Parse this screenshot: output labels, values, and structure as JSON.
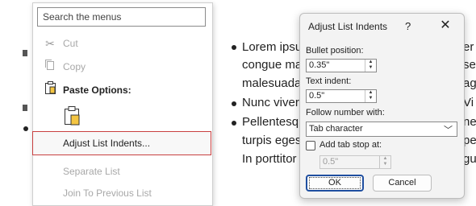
{
  "document": {
    "lines": [
      {
        "left": "Lorem ipsu",
        "right": "er"
      },
      {
        "left": "congue ma",
        "right": "sed"
      },
      {
        "left": "malesuada",
        "right": "ag"
      },
      {
        "left": "Nunc viver",
        "right": "Vi"
      },
      {
        "left": "Pellentesq",
        "right": "ne"
      },
      {
        "left": "turpis eges",
        "right": "pe"
      },
      {
        "left": "In porttitor",
        "right": "gue"
      }
    ]
  },
  "context_menu": {
    "search_placeholder": "Search the menus",
    "items": [
      {
        "label": "Cut",
        "key": "t",
        "icon": "scissors-icon",
        "enabled": false
      },
      {
        "label": "Copy",
        "key": "C",
        "icon": "copy-icon",
        "enabled": false
      },
      {
        "label": "Paste Options:",
        "icon": "clipboard-icon",
        "enabled": true,
        "header": true
      },
      {
        "label": "Adjust List Indents...",
        "key": "u",
        "enabled": true,
        "highlighted": true
      },
      {
        "label": "Separate List",
        "key": "L",
        "enabled": false
      },
      {
        "label": "Join To Previous List",
        "key": "J",
        "enabled": false
      }
    ]
  },
  "dialog": {
    "title": "Adjust List Indents",
    "help": "?",
    "close": "✕",
    "bullet_position_label": "Bullet position:",
    "bullet_position_value": "0.35\"",
    "text_indent_label": "Text indent:",
    "text_indent_value": "0.5\"",
    "follow_label": "Follow number with:",
    "follow_value": "Tab character",
    "tab_stop_label": "Add tab stop at:",
    "tab_stop_checked": false,
    "tab_stop_value": "0.5\"",
    "ok_label": "OK",
    "cancel_label": "Cancel"
  }
}
